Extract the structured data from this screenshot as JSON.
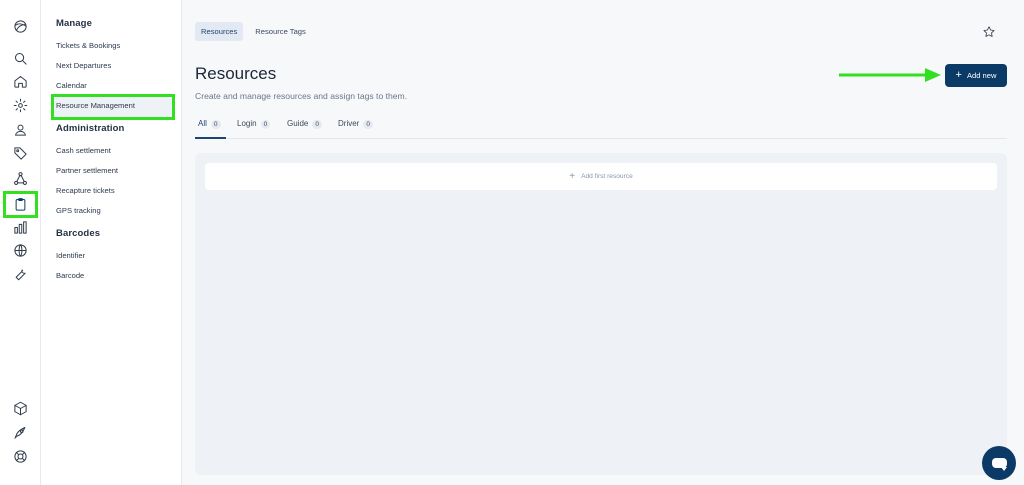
{
  "sidebar": {
    "sections": [
      {
        "title": "Manage",
        "items": [
          "Tickets & Bookings",
          "Next Departures",
          "Calendar",
          "Resource Management"
        ]
      },
      {
        "title": "Administration",
        "items": [
          "Cash settlement",
          "Partner settlement",
          "Recapture tickets",
          "GPS tracking"
        ]
      },
      {
        "title": "Barcodes",
        "items": [
          "Identifier",
          "Barcode"
        ]
      }
    ],
    "active_item": "Resource Management"
  },
  "rail": {
    "icons": [
      "logo-icon",
      "search-icon",
      "home-icon",
      "settings-icon",
      "user-icon",
      "tag-icon",
      "network-icon",
      "clipboard-icon",
      "chart-icon",
      "globe-icon",
      "wrench-icon",
      "box-icon",
      "rocket-icon",
      "help-icon"
    ],
    "active": "clipboard-icon"
  },
  "top_tabs": [
    "Resources",
    "Resource Tags"
  ],
  "page": {
    "title": "Resources",
    "subtitle": "Create and manage resources and assign tags to them.",
    "add_button": "Add new",
    "add_first": "Add first resource"
  },
  "filter_tabs": [
    {
      "label": "All",
      "count": "0"
    },
    {
      "label": "Login",
      "count": "0"
    },
    {
      "label": "Guide",
      "count": "0"
    },
    {
      "label": "Driver",
      "count": "0"
    }
  ],
  "colors": {
    "primary": "#0b3a66",
    "highlight": "#33e021"
  }
}
